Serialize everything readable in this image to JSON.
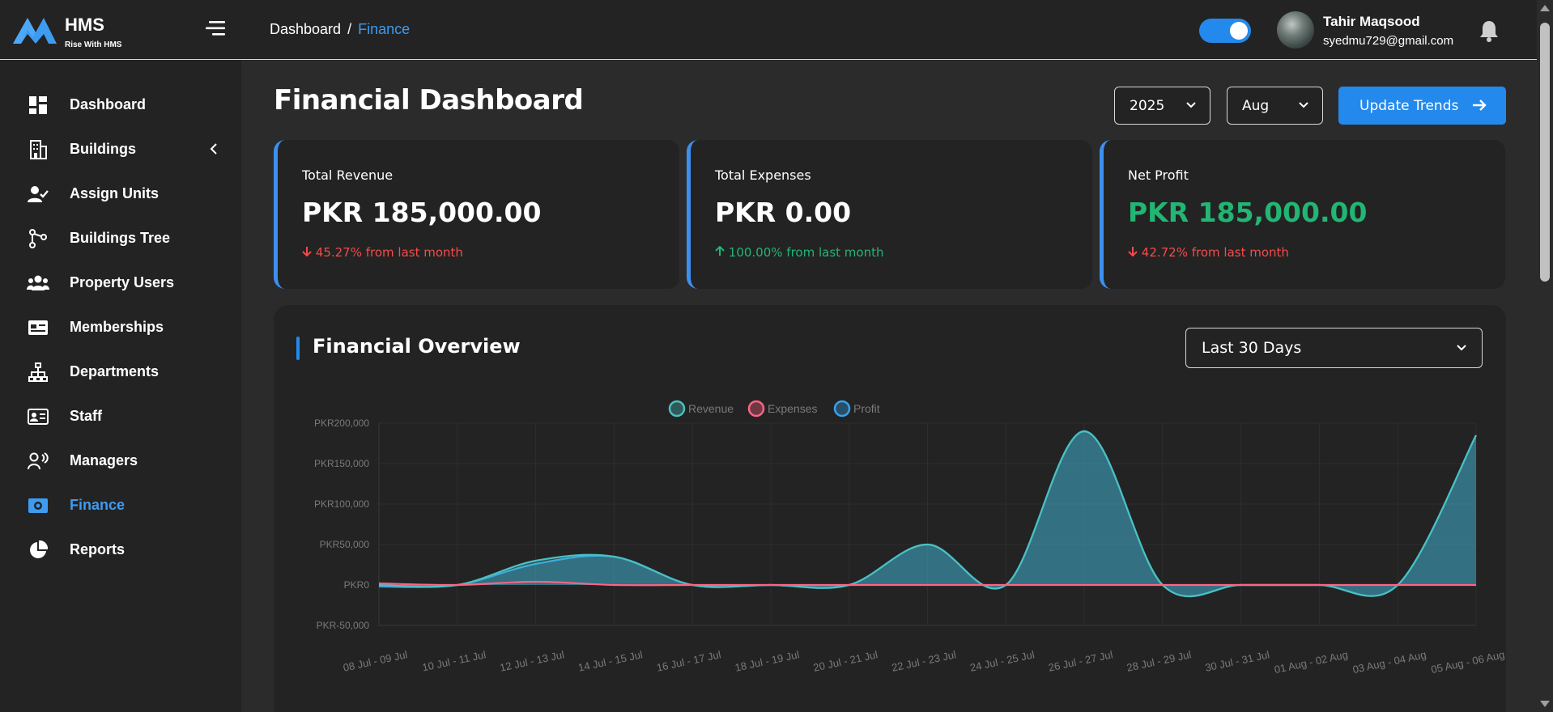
{
  "brand": {
    "name": "HMS",
    "tagline": "Rise With HMS"
  },
  "sidebar": {
    "items": [
      {
        "label": "Dashboard",
        "icon": "dashboard-icon"
      },
      {
        "label": "Buildings",
        "icon": "building-icon"
      },
      {
        "label": "Assign Units",
        "icon": "user-check-icon"
      },
      {
        "label": "Buildings Tree",
        "icon": "tree-icon"
      },
      {
        "label": "Property Users",
        "icon": "users-icon"
      },
      {
        "label": "Memberships",
        "icon": "membership-card-icon"
      },
      {
        "label": "Departments",
        "icon": "sitemap-icon"
      },
      {
        "label": "Staff",
        "icon": "id-card-icon"
      },
      {
        "label": "Managers",
        "icon": "manager-icon"
      },
      {
        "label": "Finance",
        "icon": "money-icon"
      },
      {
        "label": "Reports",
        "icon": "pie-chart-icon"
      }
    ],
    "active": "Finance"
  },
  "header": {
    "breadcrumb_root": "Dashboard",
    "breadcrumb_sep": "/",
    "breadcrumb_current": "Finance",
    "user_name": "Tahir Maqsood",
    "user_email": "syedmu729@gmail.com",
    "theme_toggle_on": true
  },
  "main": {
    "title": "Financial Dashboard",
    "year": "2025",
    "month": "Aug",
    "update_button": "Update Trends"
  },
  "cards": [
    {
      "title": "Total Revenue",
      "value": "PKR 185,000.00",
      "change": "45.27% from last month",
      "direction": "down"
    },
    {
      "title": "Total Expenses",
      "value": "PKR 0.00",
      "change": "100.00% from last month",
      "direction": "up"
    },
    {
      "title": "Net Profit",
      "value": "PKR 185,000.00",
      "change": "42.72% from last month",
      "direction": "down"
    }
  ],
  "overview": {
    "title": "Financial Overview",
    "range": "Last 30 Days"
  },
  "colors": {
    "accent": "#2389ec",
    "revenue": "#4bc0c0",
    "expenses": "#ff6384",
    "profit": "#36a2eb",
    "positive": "#22b574",
    "negative": "#f44b4b"
  },
  "chart_data": {
    "type": "area",
    "categories": [
      "08 Jul - 09 Jul",
      "10 Jul - 11 Jul",
      "12 Jul - 13 Jul",
      "14 Jul - 15 Jul",
      "16 Jul - 17 Jul",
      "18 Jul - 19 Jul",
      "20 Jul - 21 Jul",
      "22 Jul - 23 Jul",
      "24 Jul - 25 Jul",
      "26 Jul - 27 Jul",
      "28 Jul - 29 Jul",
      "30 Jul - 31 Jul",
      "01 Aug - 02 Aug",
      "03 Aug - 04 Aug",
      "05 Aug - 06 Aug"
    ],
    "series": [
      {
        "name": "Revenue",
        "values": [
          0,
          0,
          30000,
          35000,
          0,
          0,
          0,
          50000,
          0,
          190000,
          0,
          0,
          0,
          0,
          185000
        ]
      },
      {
        "name": "Expenses",
        "values": [
          2000,
          0,
          4000,
          0,
          0,
          0,
          0,
          0,
          0,
          0,
          0,
          0,
          0,
          0,
          0
        ]
      },
      {
        "name": "Profit",
        "values": [
          -2000,
          0,
          26000,
          35000,
          0,
          0,
          0,
          50000,
          0,
          190000,
          0,
          0,
          0,
          0,
          185000
        ]
      }
    ],
    "y_ticks": [
      "PKR200,000",
      "PKR150,000",
      "PKR100,000",
      "PKR50,000",
      "PKR0",
      "PKR-50,000"
    ],
    "ylim": [
      -50000,
      200000
    ],
    "legend_position": "top-center",
    "grid": true
  }
}
